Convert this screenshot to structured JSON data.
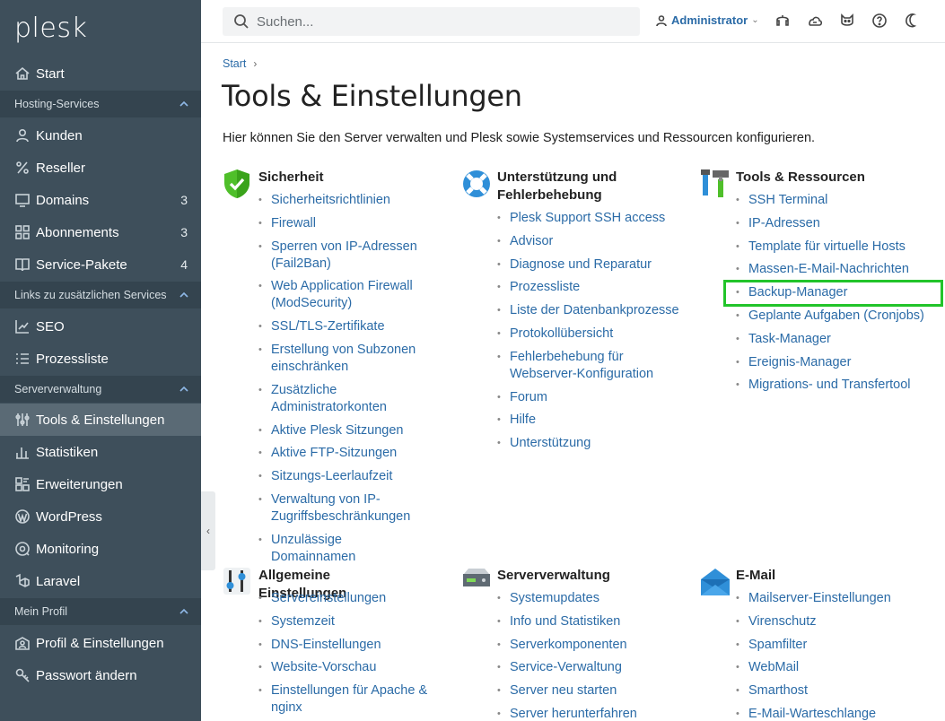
{
  "app": {
    "logo": "plesk"
  },
  "sidebar": {
    "top_item": {
      "label": "Start",
      "icon": "home-icon"
    },
    "sections": [
      {
        "label": "Hosting-Services",
        "items": [
          {
            "label": "Kunden",
            "icon": "user-icon",
            "count": ""
          },
          {
            "label": "Reseller",
            "icon": "percent-icon",
            "count": ""
          },
          {
            "label": "Domains",
            "icon": "monitor-icon",
            "count": "3"
          },
          {
            "label": "Abonnements",
            "icon": "grid-icon",
            "count": "3"
          },
          {
            "label": "Service-Pakete",
            "icon": "book-icon",
            "count": "4"
          }
        ]
      },
      {
        "label": "Links zu zusätzlichen Services",
        "items": [
          {
            "label": "SEO",
            "icon": "chart-up-icon",
            "count": ""
          },
          {
            "label": "Prozessliste",
            "icon": "list-icon",
            "count": ""
          }
        ]
      },
      {
        "label": "Serververwaltung",
        "items": [
          {
            "label": "Tools & Einstellungen",
            "icon": "sliders-icon",
            "count": "",
            "active": true
          },
          {
            "label": "Statistiken",
            "icon": "bar-chart-icon",
            "count": ""
          },
          {
            "label": "Erweiterungen",
            "icon": "puzzle-icon",
            "count": ""
          },
          {
            "label": "WordPress",
            "icon": "wordpress-icon",
            "count": ""
          },
          {
            "label": "Monitoring",
            "icon": "monitoring-icon",
            "count": ""
          },
          {
            "label": "Laravel",
            "icon": "laravel-icon",
            "count": ""
          }
        ]
      },
      {
        "label": "Mein Profil",
        "items": [
          {
            "label": "Profil & Einstellungen",
            "icon": "profile-icon",
            "count": ""
          },
          {
            "label": "Passwort ändern",
            "icon": "key-icon",
            "count": ""
          }
        ]
      }
    ]
  },
  "topbar": {
    "search_placeholder": "Suchen...",
    "user_label": "Administrator",
    "icons": [
      "headset-icon",
      "cloud-icon",
      "cat-icon",
      "help-icon",
      "moon-icon"
    ]
  },
  "breadcrumb": {
    "start": "Start"
  },
  "page": {
    "title": "Tools & Einstellungen",
    "intro": "Hier können Sie den Server verwalten und Plesk sowie Systemservices und Ressourcen konfigurieren."
  },
  "groups": {
    "sicherheit": {
      "title": "Sicherheit",
      "links": [
        "Sicherheitsrichtlinien",
        "Firewall",
        "Sperren von IP-Adressen (Fail2Ban)",
        "Web Application Firewall (ModSecurity)",
        "SSL/TLS-Zertifikate",
        "Erstellung von Subzonen einschränken",
        "Zusätzliche Administratorkonten",
        "Aktive Plesk Sitzungen",
        "Aktive FTP-Sitzungen",
        "Sitzungs-Leerlaufzeit",
        "Verwaltung von IP-Zugriffsbeschränkungen",
        "Unzulässige Domainnamen"
      ]
    },
    "unterstuetzung": {
      "title": "Unterstützung und Fehlerbehebung",
      "links": [
        "Plesk Support SSH access",
        "Advisor",
        "Diagnose und Reparatur",
        "Prozessliste",
        "Liste der Datenbankprozesse",
        "Protokollübersicht",
        "Fehlerbehebung für Webserver-Konfiguration",
        "Forum",
        "Hilfe",
        "Unterstützung"
      ]
    },
    "tools": {
      "title": "Tools & Ressourcen",
      "links": [
        "SSH Terminal",
        "IP-Adressen",
        "Template für virtuelle Hosts",
        "Massen-E-Mail-Nachrichten",
        "Backup-Manager",
        "Geplante Aufgaben (Cronjobs)",
        "Task-Manager",
        "Ereignis-Manager",
        "Migrations- und Transfertool"
      ]
    },
    "allgemein": {
      "title": "Allgemeine Einstellungen",
      "links": [
        "Servereinstellungen",
        "Systemzeit",
        "DNS-Einstellungen",
        "Website-Vorschau",
        "Einstellungen für Apache & nginx"
      ]
    },
    "serververwaltung": {
      "title": "Serververwaltung",
      "links": [
        "Systemupdates",
        "Info und Statistiken",
        "Serverkomponenten",
        "Service-Verwaltung",
        "Server neu starten",
        "Server herunterfahren"
      ]
    },
    "email": {
      "title": "E-Mail",
      "links": [
        "Mailserver-Einstellungen",
        "Virenschutz",
        "Spamfilter",
        "WebMail",
        "Smarthost",
        "E-Mail-Warteschlange"
      ]
    }
  }
}
